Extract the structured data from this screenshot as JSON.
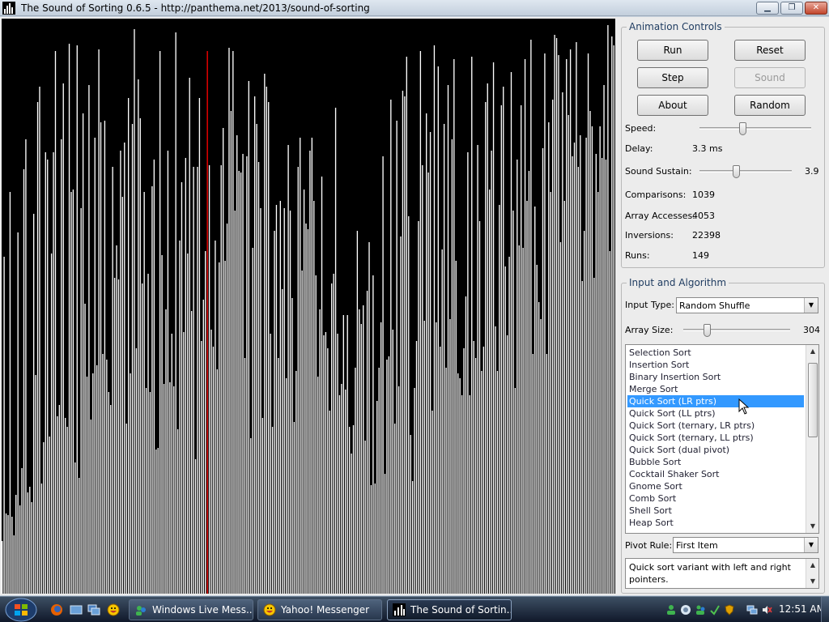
{
  "window": {
    "title": "The Sound of Sorting 0.6.5 - http://panthema.net/2013/sound-of-sorting",
    "controls": {
      "minimize": "▁",
      "maximize": "❐",
      "close": "✕"
    }
  },
  "visualization": {
    "bar_color": "#ffffff",
    "highlight_color": "#ff0000",
    "background": "#000000",
    "highlight_index": 104,
    "max_value": 304,
    "values": [
      28,
      180,
      43,
      42,
      215,
      41,
      31,
      53,
      193,
      47,
      67,
      227,
      243,
      54,
      57,
      49,
      203,
      117,
      263,
      271,
      59,
      81,
      236,
      232,
      84,
      182,
      236,
      290,
      95,
      101,
      243,
      273,
      94,
      89,
      294,
      215,
      216,
      70,
      293,
      62,
      206,
      257,
      155,
      116,
      272,
      93,
      118,
      244,
      122,
      291,
      252,
      128,
      253,
      125,
      108,
      101,
      228,
      169,
      186,
      168,
      237,
      212,
      241,
      91,
      265,
      118,
      251,
      302,
      131,
      275,
      254,
      166,
      215,
      110,
      171,
      108,
      218,
      232,
      77,
      78,
      290,
      181,
      112,
      152,
      237,
      113,
      139,
      111,
      300,
      88,
      189,
      220,
      140,
      233,
      182,
      276,
      151,
      228,
      72,
      228,
      265,
      135,
      157,
      183,
      290,
      229,
      141,
      132,
      189,
      120,
      177,
      229,
      249,
      178,
      198,
      292,
      258,
      290,
      205,
      245,
      226,
      225,
      235,
      126,
      234,
      274,
      83,
      185,
      266,
      251,
      231,
      206,
      94,
      278,
      271,
      263,
      139,
      89,
      194,
      208,
      126,
      210,
      163,
      206,
      115,
      240,
      205,
      158,
      92,
      119,
      228,
      244,
      173,
      216,
      198,
      195,
      237,
      244,
      210,
      170,
      116,
      152,
      223,
      138,
      140,
      131,
      98,
      166,
      171,
      260,
      139,
      106,
      112,
      149,
      109,
      149,
      89,
      75,
      90,
      121,
      194,
      152,
      144,
      154,
      82,
      162,
      188,
      58,
      170,
      59,
      103,
      121,
      145,
      234,
      64,
      125,
      127,
      264,
      141,
      91,
      253,
      111,
      191,
      269,
      266,
      287,
      202,
      85,
      60,
      110,
      135,
      199,
      290,
      229,
      146,
      257,
      225,
      247,
      98,
      293,
      145,
      282,
      132,
      184,
      251,
      121,
      272,
      147,
      243,
      286,
      178,
      118,
      115,
      106,
      131,
      159,
      236,
      106,
      287,
      135,
      126,
      240,
      199,
      119,
      132,
      263,
      273,
      216,
      237,
      284,
      143,
      119,
      208,
      261,
      271,
      175,
      138,
      180,
      279,
      205,
      110,
      232,
      186,
      261,
      185,
      286,
      210,
      226,
      296,
      128,
      207,
      176,
      156,
      147,
      238,
      289,
      128,
      252,
      215,
      264,
      299,
      297,
      288,
      188,
      268,
      210,
      286,
      256,
      291,
      234,
      241,
      295,
      228,
      245,
      167,
      194,
      244,
      289,
      258,
      250,
      169,
      235,
      215,
      250,
      233,
      272,
      232,
      304,
      183,
      298,
      293
    ]
  },
  "animation_controls": {
    "legend": "Animation Controls",
    "buttons": {
      "run": "Run",
      "reset": "Reset",
      "step": "Step",
      "sound": "Sound",
      "about": "About",
      "random": "Random"
    },
    "speed_label": "Speed:",
    "speed_level": 0.38,
    "delay_label": "Delay:",
    "delay_value": "3.3 ms",
    "sustain_label": "Sound Sustain:",
    "sustain_value": "3.9",
    "sustain_level": 0.39,
    "comparisons_label": "Comparisons:",
    "comparisons_value": "1039",
    "accesses_label": "Array Accesses:",
    "accesses_value": "4053",
    "inversions_label": "Inversions:",
    "inversions_value": "22398",
    "runs_label": "Runs:",
    "runs_value": "149"
  },
  "input_algorithm": {
    "legend": "Input and Algorithm",
    "input_type_label": "Input Type:",
    "input_type_value": "Random Shuffle",
    "array_size_label": "Array Size:",
    "array_size_value": "304",
    "array_size_level": 0.2,
    "algorithms": [
      "Selection Sort",
      "Insertion Sort",
      "Binary Insertion Sort",
      "Merge Sort",
      "Quick Sort (LR ptrs)",
      "Quick Sort (LL ptrs)",
      "Quick Sort (ternary, LR ptrs)",
      "Quick Sort (ternary, LL ptrs)",
      "Quick Sort (dual pivot)",
      "Bubble Sort",
      "Cocktail Shaker Sort",
      "Gnome Sort",
      "Comb Sort",
      "Shell Sort",
      "Heap Sort"
    ],
    "selected_index": 4,
    "pivot_label": "Pivot Rule:",
    "pivot_value": "First Item",
    "description": "Quick sort variant with left and right pointers."
  },
  "taskbar": {
    "tasks": [
      "Windows Live Mess...",
      "Yahoo! Messenger",
      "The Sound of Sortin..."
    ],
    "clock": "12:51 AM",
    "start_label": "Start"
  }
}
